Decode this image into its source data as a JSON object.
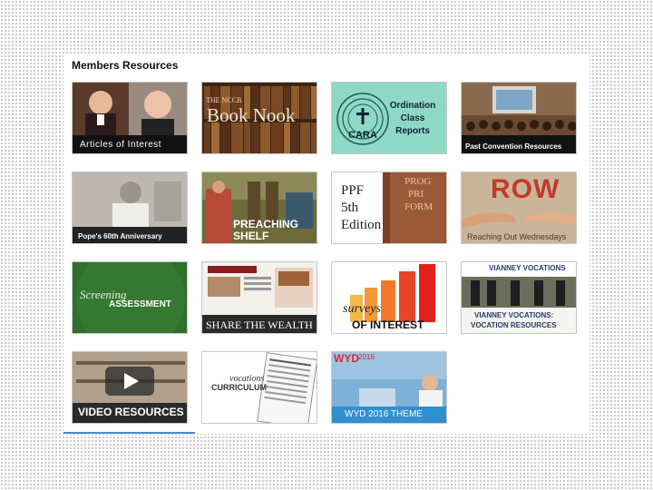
{
  "section": {
    "title": "Members Resources"
  },
  "tiles": {
    "articles": {
      "label": "Articles of Interest"
    },
    "book_nook": {
      "small": "THE NCCB",
      "big": "Book Nook"
    },
    "cara": {
      "logo": "CARA",
      "line1": "Ordination",
      "line2": "Class",
      "line3": "Reports"
    },
    "convention": {
      "label": "Past Convention Resources"
    },
    "pope": {
      "label": "Pope's 60th Anniversary"
    },
    "preaching": {
      "line1": "PREACHING",
      "line2": "SHELF"
    },
    "ppf": {
      "line1": "PPF",
      "line2": "5th",
      "line3": "Edition",
      "bg1": "PROG",
      "bg2": "PRI",
      "bg3": "FORM"
    },
    "row": {
      "big": "ROW",
      "label": "Reaching Out Wednesdays"
    },
    "screening": {
      "script": "Screening",
      "label": "ASSESSMENT"
    },
    "share": {
      "label": "SHARE THE WEALTH"
    },
    "surveys": {
      "script": "surveys",
      "label": "OF INTEREST"
    },
    "vianney": {
      "header": "VIANNEY VOCATIONS",
      "line1": "VIANNEY VOCATIONS:",
      "line2": "VOCATION RESOURCES"
    },
    "video": {
      "label": "VIDEO RESOURCES"
    },
    "curriculum": {
      "script": "vocations",
      "label": "CURRICULUM"
    },
    "wyd": {
      "badge": "WYD",
      "year": "2016",
      "label": "WYD 2016 THEME"
    }
  },
  "colors": {
    "cara_bg": "#8fd8c6",
    "screening_bg": "#2f6e2c",
    "wyd_bar": "#2f8fd0",
    "underline": "#4a8ec9"
  }
}
